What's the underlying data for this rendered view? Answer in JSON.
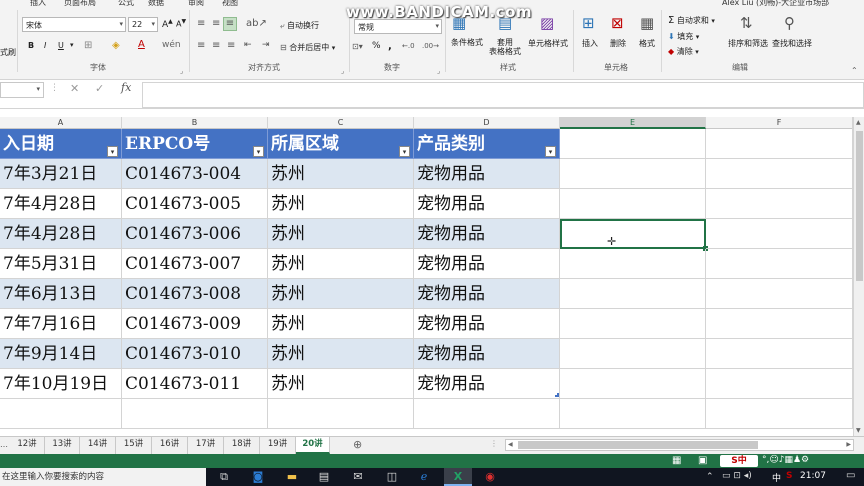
{
  "watermark": "www.BANDICAM.com",
  "ribbon": {
    "tabs": [
      "插入",
      "页面布局",
      "公式",
      "数据",
      "审阅",
      "视图"
    ],
    "user": "Alex Liu (刘畅)-大企业市场部",
    "font": {
      "name": "宋体",
      "size": "22",
      "bold": "B",
      "italic": "I",
      "underline": "U"
    },
    "alignment": {
      "wrap": "自动换行",
      "merge": "合并后居中"
    },
    "number": {
      "format": "常规",
      "percent": "%",
      "comma": ","
    },
    "styles": {
      "conditional": "条件格式",
      "table_format": "套用\n表格格式",
      "cell_styles": "单元格样式"
    },
    "cells": {
      "insert": "插入",
      "delete": "删除",
      "format": "格式"
    },
    "editing": {
      "autosum": "自动求和",
      "fill": "填充",
      "clear": "清除",
      "sort_filter": "排序和筛选",
      "find_select": "查找和选择"
    },
    "groups": {
      "font": "字体",
      "alignment": "对齐方式",
      "number": "数字",
      "styles": "样式",
      "cells": "单元格",
      "editing": "编辑"
    }
  },
  "formula_bar": {
    "fx": "fx",
    "cancel": "✕",
    "enter": "✓",
    "content": ""
  },
  "columns": [
    "A",
    "B",
    "C",
    "D",
    "E",
    "F"
  ],
  "table": {
    "headers": [
      "入日期",
      "ERPCO号",
      "所属区域",
      "产品类别"
    ],
    "rows": [
      [
        "7年3月21日",
        "C014673-004",
        "苏州",
        "宠物用品"
      ],
      [
        "7年4月28日",
        "C014673-005",
        "苏州",
        "宠物用品"
      ],
      [
        "7年4月28日",
        "C014673-006",
        "苏州",
        "宠物用品"
      ],
      [
        "7年5月31日",
        "C014673-007",
        "苏州",
        "宠物用品"
      ],
      [
        "7年6月13日",
        "C014673-008",
        "苏州",
        "宠物用品"
      ],
      [
        "7年7月16日",
        "C014673-009",
        "苏州",
        "宠物用品"
      ],
      [
        "7年9月14日",
        "C014673-010",
        "苏州",
        "宠物用品"
      ],
      [
        "7年10月19日",
        "C014673-011",
        "苏州",
        "宠物用品"
      ]
    ]
  },
  "sheet_tabs": [
    "12讲",
    "13讲",
    "14讲",
    "15讲",
    "16讲",
    "17讲",
    "18讲",
    "19讲",
    "20讲"
  ],
  "active_sheet": "20讲",
  "taskbar": {
    "search_placeholder": "在这里输入你要搜索的内容",
    "clock": "21:07",
    "ime": "中"
  },
  "colors": {
    "excel_green": "#217346",
    "table_header": "#4472c4",
    "band": "#dce6f1"
  }
}
